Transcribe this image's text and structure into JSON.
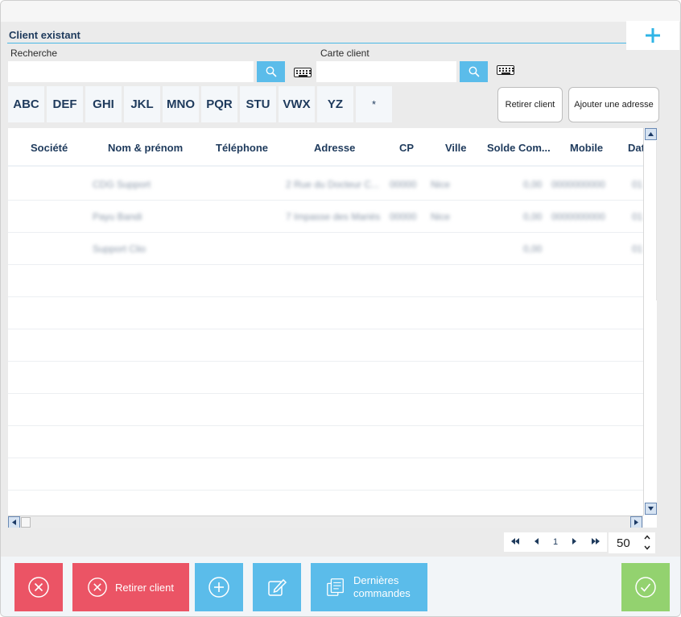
{
  "header": {
    "section_title": "Client existant",
    "add_icon": "plus-icon"
  },
  "search": {
    "label": "Recherche",
    "value": "",
    "placeholder": ""
  },
  "card": {
    "label": "Carte client",
    "value": "",
    "placeholder": ""
  },
  "alpha_filters": [
    "ABC",
    "DEF",
    "GHI",
    "JKL",
    "MNO",
    "PQR",
    "STU",
    "VWX",
    "YZ",
    "*"
  ],
  "actions": {
    "remove_client": "Retirer client",
    "add_address": "Ajouter une adresse"
  },
  "table": {
    "columns": [
      "Société",
      "Nom & prénom",
      "Téléphone",
      "Adresse",
      "CP",
      "Ville",
      "Solde Com...",
      "Mobile",
      "Dat"
    ],
    "rows": [
      {
        "societe": "",
        "nom": "CDG Support",
        "telephone": "",
        "adresse": "2 Rue du Docteur C...",
        "cp": "00000",
        "ville": "Nice",
        "solde": "0,00",
        "mobile": "0000000000",
        "date": "01"
      },
      {
        "societe": "",
        "nom": "Payu Bandi",
        "telephone": "",
        "adresse": "7 Impasse des Mariés...",
        "cp": "00000",
        "ville": "Nice",
        "solde": "0,00",
        "mobile": "0000000000",
        "date": "01"
      },
      {
        "societe": "",
        "nom": "Support Clio",
        "telephone": "",
        "adresse": "",
        "cp": "",
        "ville": "",
        "solde": "0,00",
        "mobile": "",
        "date": "01"
      }
    ]
  },
  "pagination": {
    "current_page": "1",
    "page_size": "50"
  },
  "footer": {
    "remove_client": "Retirer client",
    "last_orders": "Dernières commandes"
  },
  "colors": {
    "accent_blue": "#5bbcea",
    "danger_red": "#eb5465",
    "confirm_green": "#93d26f",
    "text_navy": "#1e3a5c"
  }
}
